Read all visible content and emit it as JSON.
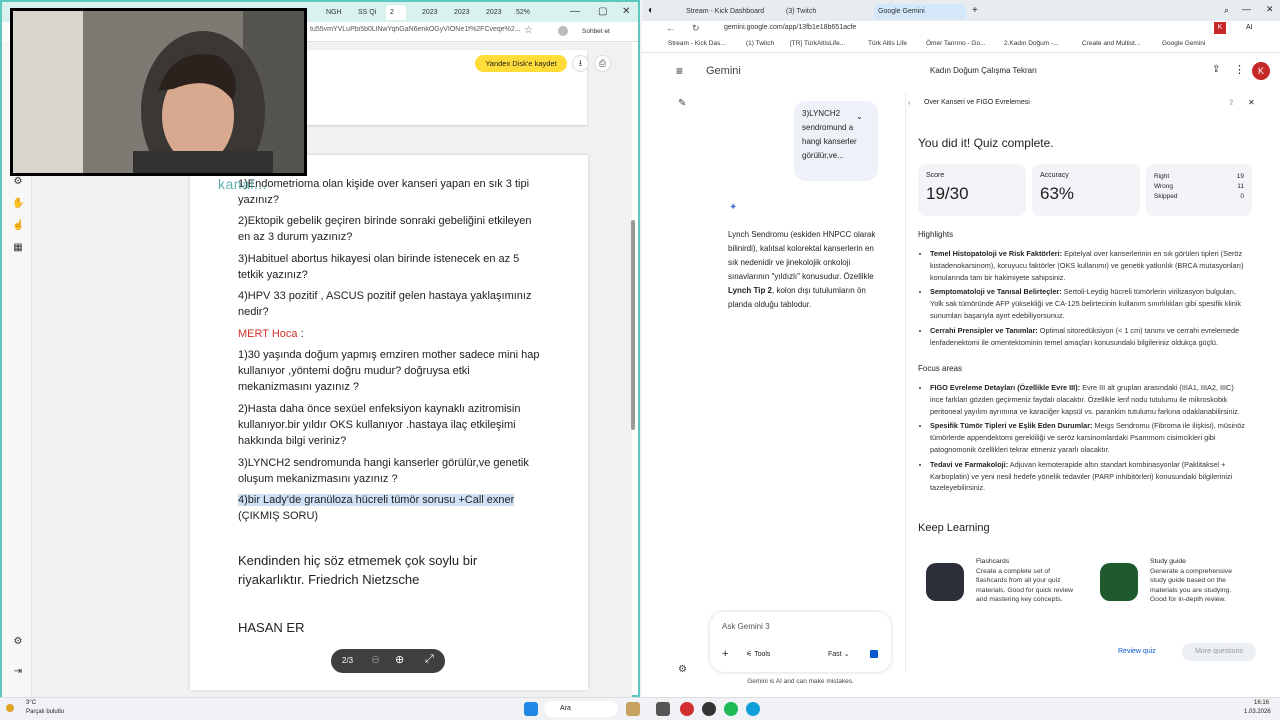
{
  "left_window": {
    "tabs": [
      "NGH",
      "SS Qi",
      "2",
      "2023",
      "2023",
      "2023",
      "52%"
    ],
    "url": "tu55vmYVLuPbi5b0LlNwYqhGaN6enkOGyVIONe1f%2FCveqe%2...",
    "profile_label": "Sohbet et",
    "yandex_button": "Yandex Disk'e kaydet",
    "page_indicator": "2/3",
    "watermark": "kanal..."
  },
  "document": {
    "lines": [
      "1)Endometrioma olan kişide over kanseri yapan en sık 3 tipi yazınız?",
      "2)Ektopik gebelik geçiren birinde sonraki gebeliğini etkileyen en az 3 durum yazınız?",
      "3)Habituel abortus hikayesi olan birinde istenecek en az 5 tetkik yazınız?",
      "4)HPV 33 pozitif , ASCUS pozitif gelen hastaya yaklaşımınız nedir?"
    ],
    "teacher": "MERT Hoca",
    "teacher_suffix": " :",
    "mert_lines": [
      "1)30 yaşında doğum yapmış emziren mother sadece mini hap kullanıyor ,yöntemi doğru mudur? doğruysa etki mekanizmasını yazınız ?",
      "2)Hasta daha önce sexüel enfeksiyon kaynaklı azitromisin kullanıyor.bir yıldır OKS kullanıyor .hastaya ilaç etkileşimi hakkında bilgi veriniz?",
      "3)LYNCH2 sendromunda hangi kanserler görülür,ve genetik oluşum mekanizmasını yazınız ?"
    ],
    "highlighted_line": "4)bir Lady'de granüloza hücreli tümör sorusu +Call exner",
    "highlight_tail": "(ÇIKMIŞ SORU)",
    "quote": "Kendinden hiç söz etmemek çok soylu bir riyakarlıktır. Friedrich Nietzsche",
    "author": "HASAN ER"
  },
  "right_window": {
    "tabs": [
      "Stream - Kick Dashboard",
      "(3) Twitch",
      "Google Gemini"
    ],
    "url": "gemini.google.com/app/13fb1e18b651acfe",
    "bookmarks": [
      "Stream - Kick Das...",
      "(1) Twitch",
      "[TR] TürkAltisLife...",
      "Türk Altis Life",
      "Ömer Tanrıno - Go...",
      "2.Kadın Doğum -...",
      "Create and Multist...",
      "Google Gemini"
    ],
    "app_name": "Gemini",
    "chat_title": "Kadın Doğum Çalışma Tekrarı",
    "avatar_letter": "K",
    "user_message": "3)LYNCH2 sendromund a hangi kanserler görülür,ve...",
    "response_pre": "Lynch Sendromu (eskiden HNPCC olarak bilinirdi), kalıtsal kolorektal kanserlerin en sık nedenidir ve jinekolojik onkoloji sınavlarının \"yıldızlı\" konusudur. Özellikle ",
    "response_bold": "Lynch Tip 2",
    "response_post": ", kolon dışı tutulumların ön planda olduğu tablodur.",
    "ask_placeholder": "Ask Gemini 3",
    "tools_label": "Tools",
    "mode_label": "Fast",
    "disclaimer": "Gemini is AI and can make mistakes."
  },
  "quiz_panel": {
    "title": "Over Kanseri ve FIGO Evrelemesi",
    "done": "You did it! Quiz complete.",
    "score_label": "Score",
    "score_value": "19/30",
    "accuracy_label": "Accuracy",
    "accuracy_value": "63%",
    "right_label": "Right",
    "right_value": "19",
    "wrong_label": "Wrong",
    "wrong_value": "11",
    "skipped_label": "Skipped",
    "skipped_value": "0",
    "highlights_title": "Highlights",
    "highlights": [
      {
        "head": "Temel Histopatoloji ve Risk Faktörleri:",
        "body": " Epitelyal over kanserlerinin en sık görülen tipleri (Seröz kistadenokarsinom), koruyucu faktörler (OKS kullanımı) ve genetik yatkınlık (BRCA mutasyonları) konularında tam bir hakimiyete sahipsiniz."
      },
      {
        "head": "Semptomatoloji ve Tanısal Belirteçler:",
        "body": " Sertoli-Leydig hücreli tümörlerin virilizasyon bulguları, Yolk sak tümöründe AFP yüksekliği ve CA-125 belirtecinin kullanım sınırlılıkları gibi spesifik klinik sunumları başarıyla ayırt edebiliyorsunuz."
      },
      {
        "head": "Cerrahi Prensipler ve Tanımlar:",
        "body": " Optimal sitoredüksiyon (< 1 cm) tanımı ve cerrahi evrelemede lenfadenektomi ile omentektominin temel amaçları konusundaki bilgileriniz oldukça güçlü."
      }
    ],
    "focus_title": "Focus areas",
    "focus": [
      {
        "head": "FIGO Evreleme Detayları (Özellikle Evre III):",
        "body": " Evre III alt grupları arasındaki (IIIA1, IIIA2, IIIC) ince farkları gözden geçirmeniz faydalı olacaktır. Özellikle lenf nodu tutulumu ile mikroskobik peritoneal yayılım ayrımına ve karaciğer kapsül vs. parankim tutulumu farkına odaklanabilirsiniz."
      },
      {
        "head": "Spesifik Tümör Tipleri ve Eşlik Eden Durumlar:",
        "body": " Meigs Sendromu (Fibroma ile ilişkisi), müsinöz tümörlerde appendektomi gerekliliği ve seröz karsinomlardaki Psammom cisimcikleri gibi patognomonik özellikleri tekrar etmeniz yararlı olacaktır."
      },
      {
        "head": "Tedavi ve Farmakoloji:",
        "body": " Adjuvan kemoterapide altın standart kombinasyonlar (Paklitaksel + Karboplatin) ve yeni nesil hedefe yönelik tedaviler (PARP inhibitörleri) konusundaki bilgilerinizi tazeleyebilirsiniz."
      }
    ],
    "keep_learning": "Keep Learning",
    "flashcards_title": "Flashcards",
    "flashcards_desc": "Create a complete set of flashcards from all your quiz materials. Good for quick review and mastering key concepts.",
    "study_title": "Study guide",
    "study_desc": "Generate a comprehensive study guide based on the materials you are studying. Good for in-depth review.",
    "review_btn": "Review quiz",
    "more_btn": "More questions"
  },
  "taskbar": {
    "weather_temp": "3°C",
    "weather_desc": "Parçalı bulutlu",
    "search": "Ara",
    "time": "16:16",
    "date": "1.03.2026"
  },
  "colors": {
    "accent": "#0b57d0",
    "teal_border": "#5ec8c0",
    "highlight": "#cfe0f5",
    "yellow": "#ffdc37"
  }
}
